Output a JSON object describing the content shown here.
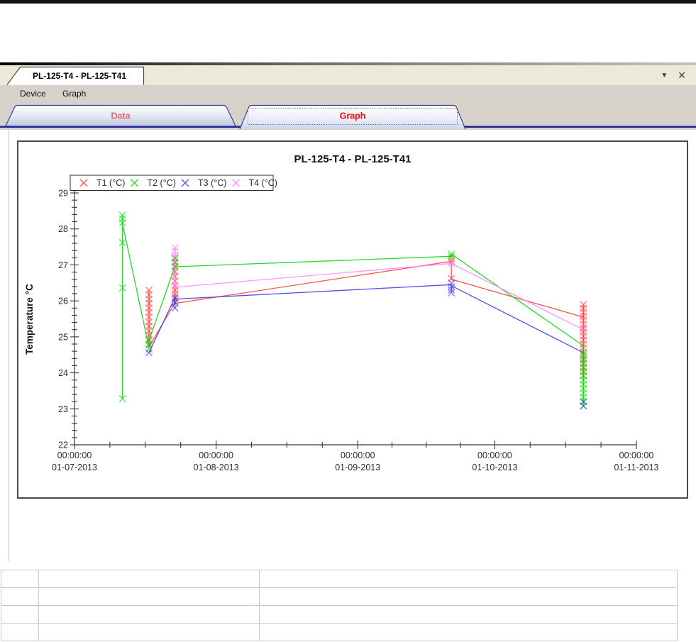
{
  "titlebar": {
    "document_tab": "PL-125-T4 - PL-125-T41",
    "dropdown_glyph": "▼",
    "close_glyph": "✕"
  },
  "menubar": {
    "items": [
      "Device",
      "Graph"
    ]
  },
  "page_tabs": {
    "data_label": "Data",
    "graph_label": "Graph",
    "data_color": "#e06a6a",
    "graph_color": "#ff0000"
  },
  "chart_data": {
    "type": "scatter",
    "title": "PL-125-T4 - PL-125-T41",
    "ylabel": "Temperature °C",
    "ylim": [
      22,
      29
    ],
    "y_major_step": 1,
    "y_minor_step": 0.2,
    "x_unit": "days since 01-07-2013",
    "x_range_days": [
      0,
      123
    ],
    "x_major_ticks": [
      {
        "day": 0,
        "time": "00:00:00",
        "date": "01-07-2013"
      },
      {
        "day": 31,
        "time": "00:00:00",
        "date": "01-08-2013"
      },
      {
        "day": 62,
        "time": "00:00:00",
        "date": "01-09-2013"
      },
      {
        "day": 92,
        "time": "00:00:00",
        "date": "01-10-2013"
      },
      {
        "day": 123,
        "time": "00:00:00",
        "date": "01-11-2013"
      }
    ],
    "x_minor_divisions": 4,
    "grid": false,
    "legend_position": "top-left",
    "axis_color": "#3a3a3a",
    "text_color": "#2c2c2c",
    "series": [
      {
        "name": "T1 (°C)",
        "color": "#ff3232",
        "line": [
          [
            16.3,
            26.3
          ],
          [
            16.3,
            24.72
          ],
          [
            22,
            25.95
          ],
          [
            22,
            27.2
          ],
          [
            22,
            25.93
          ],
          [
            82.5,
            27.1
          ],
          [
            82.5,
            26.6
          ],
          [
            111.4,
            25.55
          ],
          [
            111.4,
            25.9
          ],
          [
            111.4,
            23.9
          ]
        ],
        "points": [
          [
            16.3,
            26.3
          ],
          [
            16.3,
            26.17
          ],
          [
            16.3,
            26.05
          ],
          [
            16.3,
            25.93
          ],
          [
            16.3,
            25.8
          ],
          [
            16.3,
            25.68
          ],
          [
            16.3,
            25.55
          ],
          [
            16.3,
            25.42
          ],
          [
            16.3,
            25.3
          ],
          [
            16.3,
            25.17
          ],
          [
            16.3,
            25.05
          ],
          [
            16.3,
            24.92
          ],
          [
            16.3,
            24.8
          ],
          [
            22,
            27.2
          ],
          [
            22,
            27.07
          ],
          [
            22,
            26.94
          ],
          [
            22,
            26.81
          ],
          [
            22,
            26.68
          ],
          [
            22,
            26.55
          ],
          [
            22,
            26.42
          ],
          [
            22,
            26.3
          ],
          [
            22,
            26.18
          ],
          [
            22,
            26.06
          ],
          [
            22,
            25.95
          ],
          [
            82.5,
            27.18
          ],
          [
            82.5,
            27.1
          ],
          [
            82.5,
            26.62
          ],
          [
            111.4,
            25.9
          ],
          [
            111.4,
            25.79
          ],
          [
            111.4,
            25.68
          ],
          [
            111.4,
            25.57
          ],
          [
            111.4,
            25.46
          ],
          [
            111.4,
            25.35
          ],
          [
            111.4,
            25.24
          ],
          [
            111.4,
            25.13
          ],
          [
            111.4,
            25.02
          ],
          [
            111.4,
            24.91
          ],
          [
            111.4,
            24.8
          ],
          [
            111.4,
            24.69
          ],
          [
            111.4,
            24.58
          ],
          [
            111.4,
            24.47
          ],
          [
            111.4,
            24.36
          ],
          [
            111.4,
            24.25
          ],
          [
            111.4,
            24.14
          ],
          [
            111.4,
            24.03
          ],
          [
            111.4,
            23.92
          ]
        ]
      },
      {
        "name": "T2 (°C)",
        "color": "#00d400",
        "line": [
          [
            10.5,
            28.38
          ],
          [
            10.5,
            23.28
          ],
          [
            10.5,
            28.15
          ],
          [
            16.3,
            24.7
          ],
          [
            16.3,
            24.9
          ],
          [
            22,
            26.97
          ],
          [
            22,
            27.18
          ],
          [
            22,
            26.95
          ],
          [
            82.5,
            27.24
          ],
          [
            82.5,
            27.3
          ],
          [
            111.4,
            24.75
          ],
          [
            111.4,
            23.08
          ]
        ],
        "points": [
          [
            10.5,
            28.38
          ],
          [
            10.5,
            28.28
          ],
          [
            10.5,
            28.17
          ],
          [
            10.5,
            27.62
          ],
          [
            10.5,
            26.36
          ],
          [
            10.5,
            23.28
          ],
          [
            16.3,
            24.9
          ],
          [
            16.3,
            24.78
          ],
          [
            16.3,
            24.66
          ],
          [
            22,
            27.18
          ],
          [
            22,
            27.08
          ],
          [
            22,
            26.97
          ],
          [
            82.5,
            27.3
          ],
          [
            82.5,
            27.24
          ],
          [
            111.4,
            24.52
          ],
          [
            111.4,
            24.4
          ],
          [
            111.4,
            24.28
          ],
          [
            111.4,
            24.16
          ],
          [
            111.4,
            24.04
          ],
          [
            111.4,
            23.92
          ],
          [
            111.4,
            23.8
          ],
          [
            111.4,
            23.68
          ],
          [
            111.4,
            23.56
          ],
          [
            111.4,
            23.44
          ],
          [
            111.4,
            23.32
          ],
          [
            111.4,
            23.2
          ],
          [
            111.4,
            23.08
          ]
        ]
      },
      {
        "name": "T3 (°C)",
        "color": "#3333e6",
        "line": [
          [
            16.3,
            24.56
          ],
          [
            22,
            26.1
          ],
          [
            22,
            25.8
          ],
          [
            22,
            26.05
          ],
          [
            82.5,
            26.45
          ],
          [
            82.5,
            26.25
          ],
          [
            82.5,
            26.42
          ],
          [
            111.4,
            24.56
          ]
        ],
        "points": [
          [
            16.3,
            24.56
          ],
          [
            22,
            26.1
          ],
          [
            22,
            25.96
          ],
          [
            22,
            25.8
          ],
          [
            82.5,
            26.5
          ],
          [
            82.5,
            26.4
          ],
          [
            82.5,
            26.3
          ],
          [
            82.5,
            26.22
          ],
          [
            111.4,
            23.2
          ],
          [
            111.4,
            23.08
          ]
        ]
      },
      {
        "name": "T4 (°C)",
        "color": "#ff82ff",
        "line": [
          [
            22,
            27.48
          ],
          [
            22,
            26.38
          ],
          [
            82.5,
            27.04
          ],
          [
            111.4,
            25.2
          ]
        ],
        "points": [
          [
            22,
            27.48
          ],
          [
            22,
            27.38
          ],
          [
            22,
            27.28
          ],
          [
            22,
            26.36
          ],
          [
            82.5,
            27.04
          ],
          [
            111.4,
            25.2
          ]
        ]
      }
    ]
  },
  "bottom_table": {
    "rows": 4,
    "columns": 3,
    "cells": [
      [
        "",
        "",
        ""
      ],
      [
        "",
        "",
        ""
      ],
      [
        "",
        "",
        ""
      ],
      [
        "",
        "",
        ""
      ]
    ]
  }
}
